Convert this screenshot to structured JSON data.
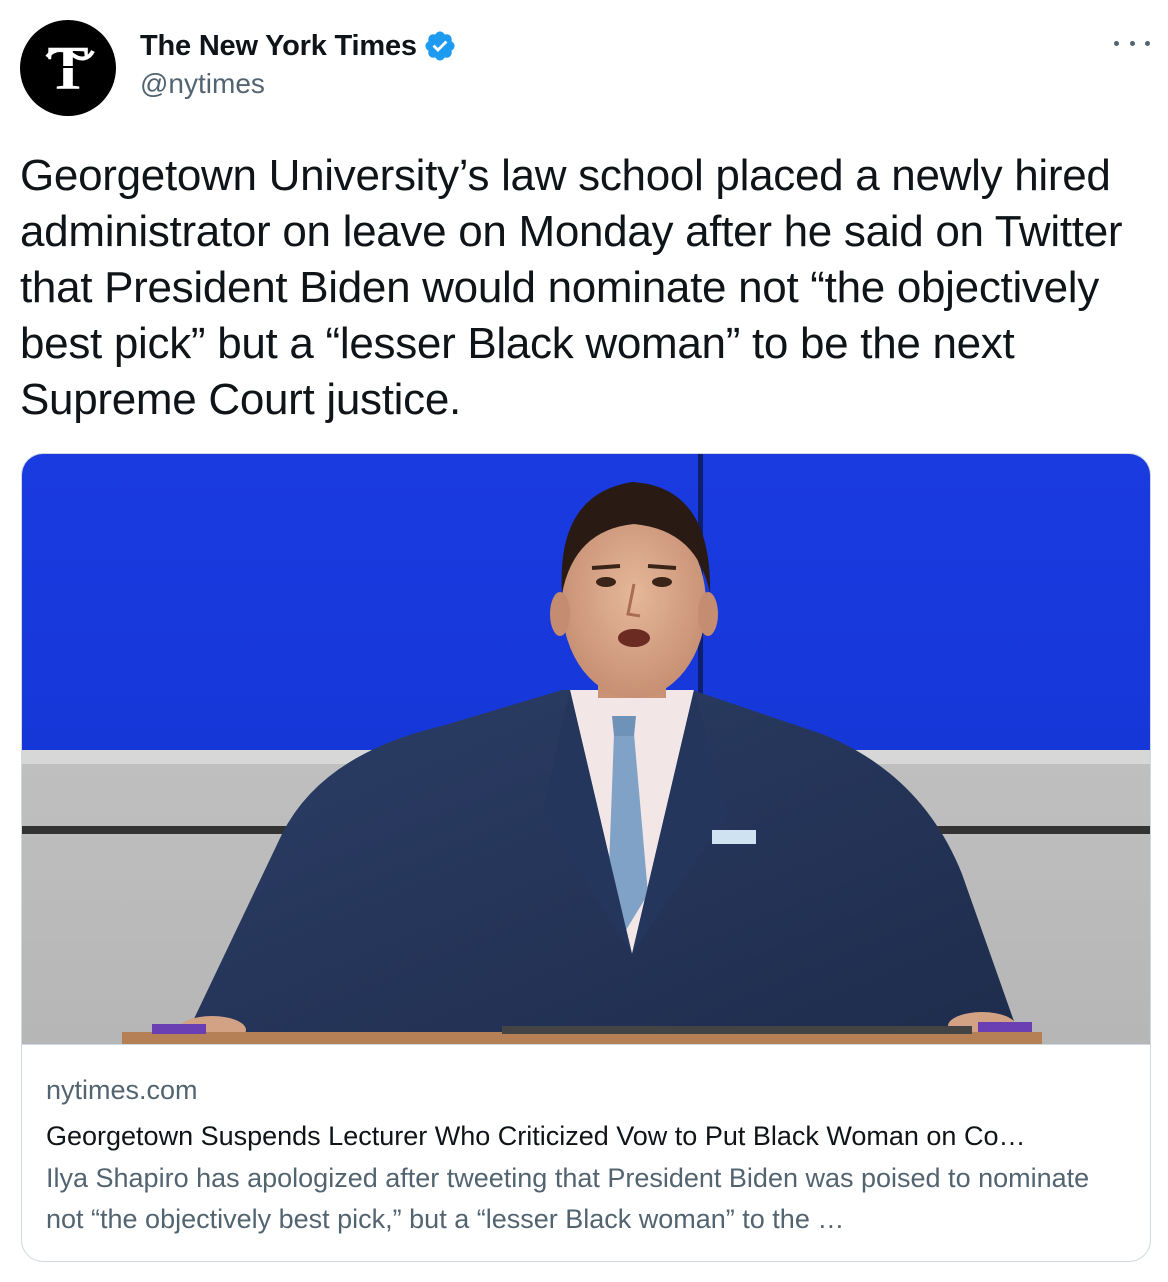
{
  "author": {
    "display_name": "The New York Times",
    "handle": "@nytimes",
    "avatar_icon": "nyt-logo-icon",
    "verified": true
  },
  "tweet": {
    "text": "Georgetown University’s law school placed a newly hired administrator on leave on Monday after he said on Twitter that President Biden would nominate not “the objectively best pick” but a “lesser Black woman” to be the next Supreme Court justice."
  },
  "card": {
    "domain": "nytimes.com",
    "title": "Georgetown Suspends Lecturer Who Criticized Vow to Put Black Woman on Co…",
    "description": "Ilya Shapiro has apologized after tweeting that President Biden was poised to nominate not “the objectively best pick,” but a “lesser Black woman” to the …"
  },
  "colors": {
    "text_primary": "#0f1419",
    "text_secondary": "#536471",
    "verified_blue": "#1d9bf0",
    "border": "#cfd9de"
  }
}
